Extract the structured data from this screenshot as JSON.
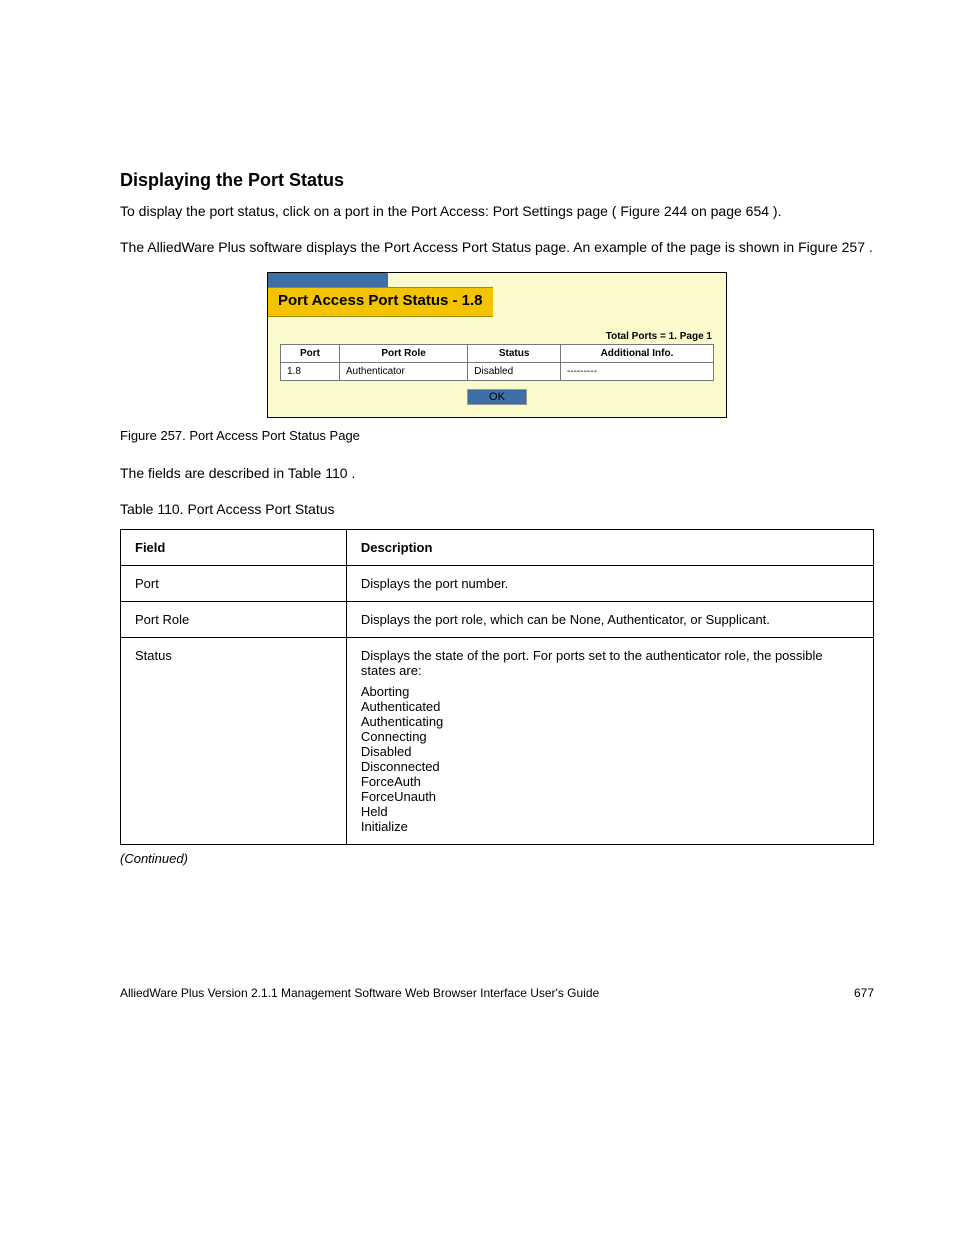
{
  "heading": "Displaying the Port Status",
  "para1": "To display the port status, click on a port in the Port Access: Port Settings page ( Figure 244 on page 654 ).",
  "para2": "The AlliedWare Plus software displays the Port Access Port Status page. An example of the page is shown in Figure 257 .",
  "dialog": {
    "title": "Port Access Port Status - 1.8",
    "meta": "Total Ports = 1. Page 1",
    "headers": {
      "c1": "Port",
      "c2": "Port Role",
      "c3": "Status",
      "c4": "Additional Info."
    },
    "row": {
      "c1": "1.8",
      "c2": "Authenticator",
      "c3": "Disabled",
      "c4": "---------"
    },
    "ok": "OK"
  },
  "figure_caption": "Figure 257. Port Access Port Status Page",
  "lead": "The fields are described in Table 110 .",
  "ref_table": {
    "caption": "Table 110. Port Access Port Status",
    "hdr1": "Field",
    "hdr2": "Description",
    "rows": [
      {
        "f": "Port",
        "d": "Displays the port number."
      },
      {
        "f": "Port Role",
        "d": "Displays the port role, which can be None, Authenticator, or Supplicant."
      },
      {
        "f": "Status",
        "d_intro": "Displays the state of the port. For ports set to the authenticator role, the possible states are:",
        "items": [
          "Aborting",
          "Authenticated",
          "Authenticating",
          "Connecting",
          "Disabled",
          "Disconnected",
          "ForceAuth",
          "ForceUnauth",
          "Held",
          "Initialize"
        ]
      }
    ]
  },
  "continued": "(Continued)",
  "footer_left": "AlliedWare Plus Version 2.1.1 Management Software Web Browser Interface User's Guide",
  "footer_right": "677"
}
